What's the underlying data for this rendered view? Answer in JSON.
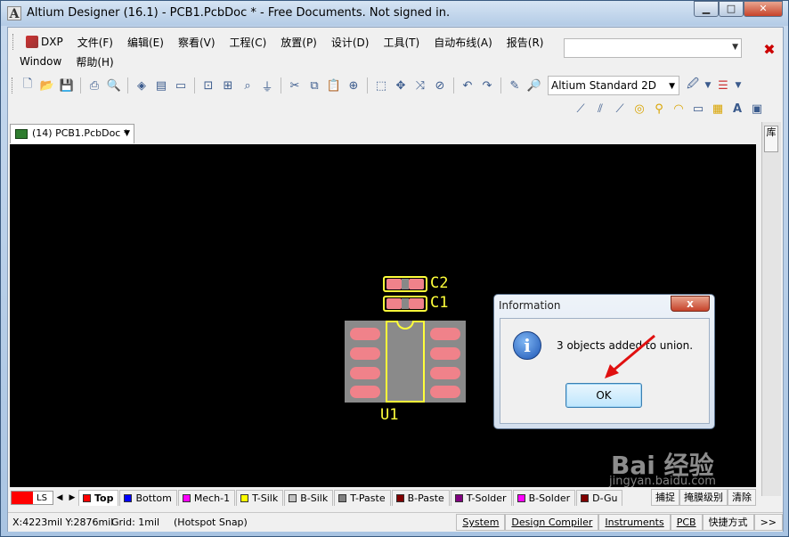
{
  "window": {
    "app_icon": "A",
    "title": "Altium Designer (16.1) - PCB1.PcbDoc * - Free Documents. Not signed in.",
    "minimize": "▁",
    "maximize": "□",
    "close": "✕"
  },
  "menu": {
    "row1": [
      "DXP",
      "文件(F)",
      "编辑(E)",
      "察看(V)",
      "工程(C)",
      "放置(P)",
      "设计(D)",
      "工具(T)",
      "自动布线(A)",
      "报告(R)"
    ],
    "row2": [
      "Window",
      "帮助(H)"
    ]
  },
  "toolbar": {
    "view_mode": "Altium Standard 2D"
  },
  "doc_tab": {
    "label": "(14) PCB1.PcbDoc *"
  },
  "dock": {
    "tab_label": "库"
  },
  "pcb": {
    "labels": [
      "C2",
      "C1",
      "U1"
    ]
  },
  "dialog": {
    "title": "Information",
    "close": "x",
    "icon": "i",
    "message": "3 objects added to union.",
    "ok": "OK"
  },
  "layers": {
    "current_set": "LS",
    "tabs": [
      {
        "name": "Top",
        "color": "#ff0000"
      },
      {
        "name": "Bottom",
        "color": "#0000ff"
      },
      {
        "name": "Mech-1",
        "color": "#ff00ff"
      },
      {
        "name": "T-Silk",
        "color": "#ffff00"
      },
      {
        "name": "B-Silk",
        "color": "#c0c0c0"
      },
      {
        "name": "T-Paste",
        "color": "#808080"
      },
      {
        "name": "B-Paste",
        "color": "#800000"
      },
      {
        "name": "T-Solder",
        "color": "#800080"
      },
      {
        "name": "B-Solder",
        "color": "#ff00ff"
      },
      {
        "name": "D-Gu",
        "color": "#800000"
      }
    ],
    "right_buttons": [
      "捕捉",
      "掩膜级别",
      "清除"
    ]
  },
  "status": {
    "coords": "X:4223mil Y:2876mil",
    "grid": "Grid: 1mil",
    "snap": "(Hotspot Snap)",
    "panels": [
      "System",
      "Design Compiler",
      "Instruments",
      "PCB",
      "快捷方式",
      ">>"
    ]
  },
  "watermark": {
    "text": "Bai 经验",
    "sub": "jingyan.baidu.com"
  }
}
